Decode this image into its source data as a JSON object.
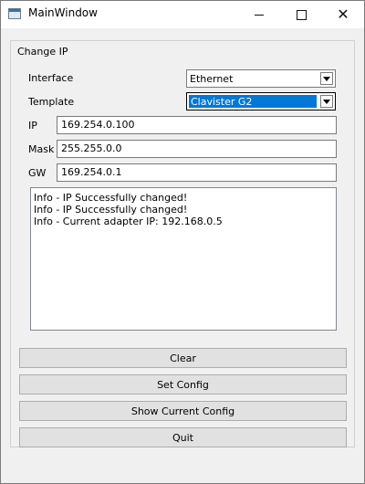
{
  "window": {
    "title": "MainWindow"
  },
  "titlebar_icons": {
    "minimize": "minimize-icon",
    "maximize": "maximize-icon",
    "close": "close-icon"
  },
  "group": {
    "title": "Change IP"
  },
  "form": {
    "interface_label": "Interface",
    "interface_value": "Ethernet",
    "template_label": "Template",
    "template_value": "Clavister G2",
    "ip_label": "IP",
    "ip_value": "169.254.0.100",
    "mask_label": "Mask",
    "mask_value": "255.255.0.0",
    "gw_label": "GW",
    "gw_value": "169.254.0.1"
  },
  "log": {
    "lines": [
      "Info - IP Successfully changed!",
      "Info - IP Successfully changed!",
      "Info - Current adapter IP: 192.168.0.5"
    ]
  },
  "buttons": {
    "clear": "Clear",
    "set_config": "Set Config",
    "show_current_config": "Show Current Config",
    "quit": "Quit"
  },
  "colors": {
    "selection": "#0078d7",
    "window_bg": "#f0f0f0",
    "button_bg": "#e1e1e1"
  }
}
